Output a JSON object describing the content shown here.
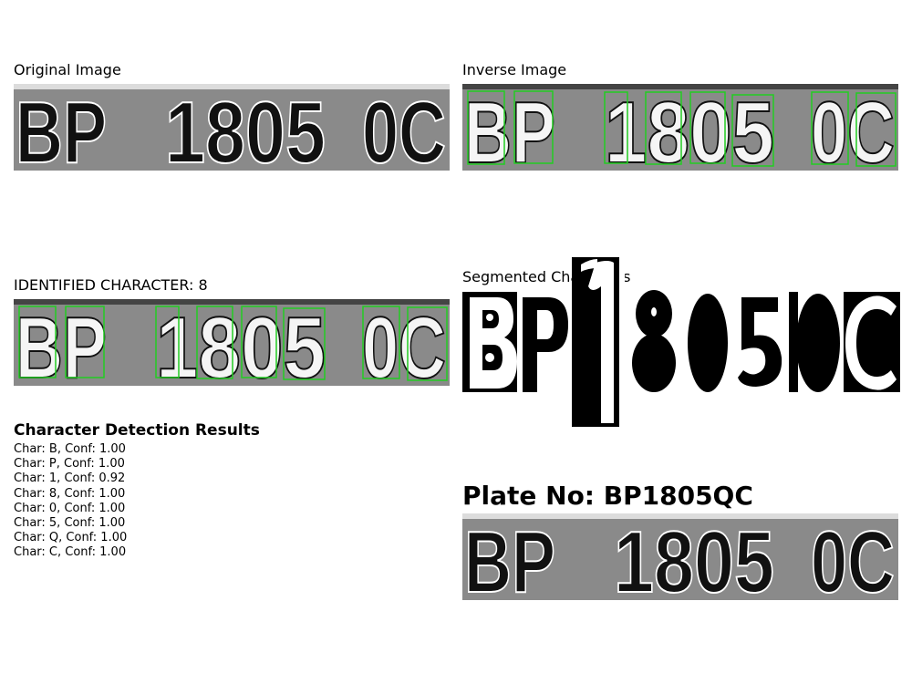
{
  "panels": {
    "original": {
      "title": "Original Image"
    },
    "inverse": {
      "title": "Inverse Image"
    },
    "identified": {
      "title": "IDENTIFIED CHARACTER: 8"
    },
    "segmented": {
      "title": "Segmented Characters"
    }
  },
  "plate_text": {
    "left": "BP",
    "middle": "1805",
    "right": "0C"
  },
  "detection": {
    "heading": "Character Detection Results",
    "items": [
      "Char: B, Conf: 1.00",
      "Char: P, Conf: 1.00",
      "Char: 1, Conf: 0.92",
      "Char: 8, Conf: 1.00",
      "Char: 0, Conf: 1.00",
      "Char: 5, Conf: 1.00",
      "Char: Q, Conf: 1.00",
      "Char: C, Conf: 1.00"
    ]
  },
  "plate_number": "Plate No: BP1805QC",
  "colors": {
    "box": "#22cc22",
    "plate_bg": "#8a8a8a"
  }
}
